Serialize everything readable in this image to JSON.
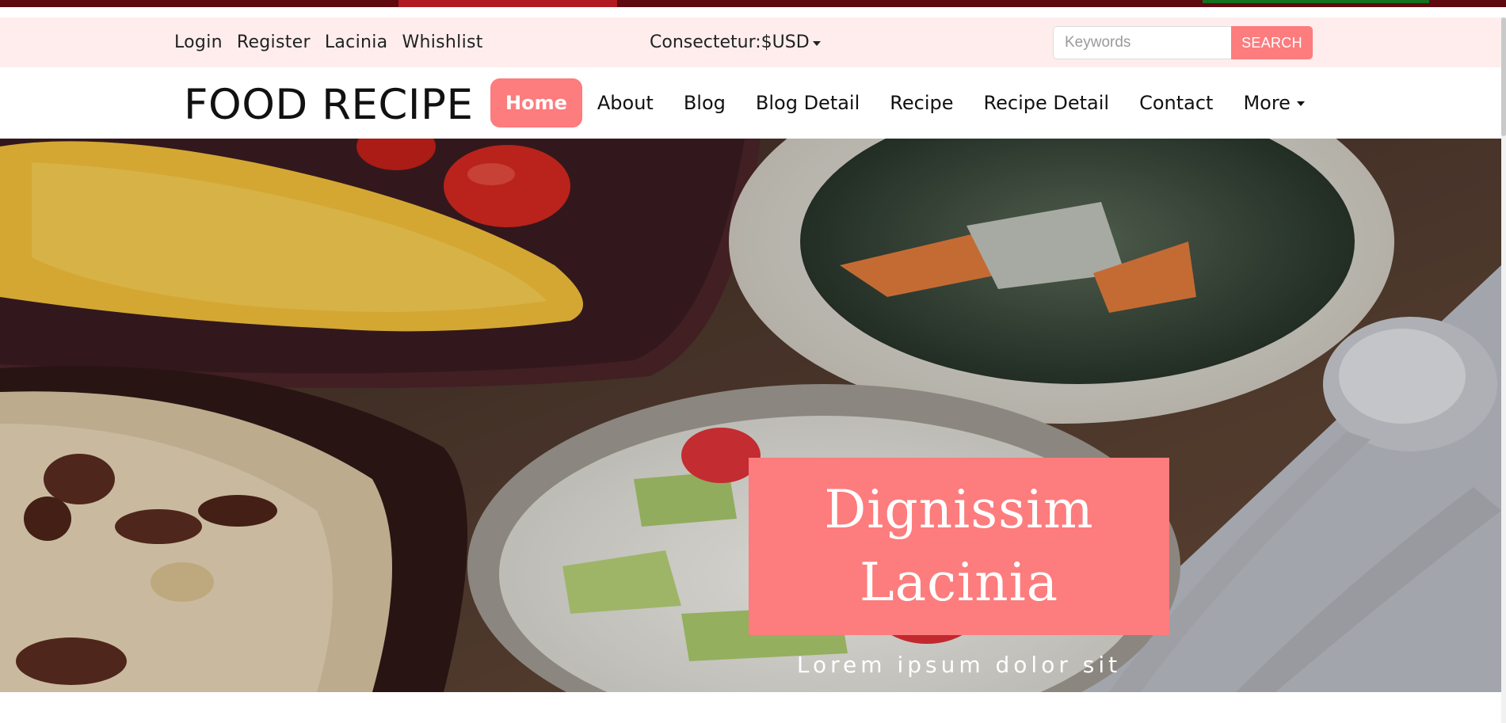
{
  "utility_bar": {
    "links": [
      "Login",
      "Register",
      "Lacinia",
      "Whishlist"
    ],
    "currency_label": "Consectetur:$USD",
    "search": {
      "placeholder": "Keywords",
      "button_label": "SEARCH"
    }
  },
  "navbar": {
    "brand": "FOOD RECIPE",
    "items": [
      "Home",
      "About",
      "Blog",
      "Blog Detail",
      "Recipe",
      "Recipe Detail",
      "Contact",
      "More"
    ],
    "active": "Home"
  },
  "hero": {
    "title_line1": "Dignissim",
    "title_line2": "Lacinia",
    "subtitle": "Lorem ipsum dolor sit"
  },
  "colors": {
    "accent": "#fd7c7d",
    "utility_bg": "#ffeded",
    "top_strip": "#5e0a10"
  }
}
